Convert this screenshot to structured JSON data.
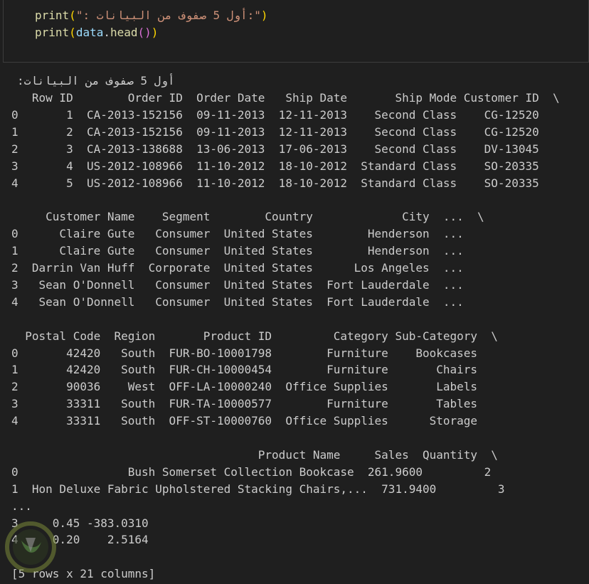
{
  "code": {
    "line1": {
      "fn": "print",
      "open": "(",
      "str": "\": أول 5 صفوف من البيانات:\"",
      "close": ")"
    },
    "line2": {
      "fn": "print",
      "open": "(",
      "obj": "data",
      "dot": ".",
      "method": "head",
      "inner_open": "(",
      "inner_close": ")",
      "close": ")"
    }
  },
  "output": {
    "heading": "أول 5 صفوف من البيانات:",
    "lines": [
      "   Row ID        Order ID  Order Date   Ship Date       Ship Mode Customer ID  \\",
      "0       1  CA-2013-152156  09-11-2013  12-11-2013    Second Class    CG-12520",
      "1       2  CA-2013-152156  09-11-2013  12-11-2013    Second Class    CG-12520",
      "2       3  CA-2013-138688  13-06-2013  17-06-2013    Second Class    DV-13045",
      "3       4  US-2012-108966  11-10-2012  18-10-2012  Standard Class    SO-20335",
      "4       5  US-2012-108966  11-10-2012  18-10-2012  Standard Class    SO-20335",
      "",
      "     Customer Name    Segment        Country             City  ...  \\",
      "0      Claire Gute   Consumer  United States        Henderson  ...",
      "1      Claire Gute   Consumer  United States        Henderson  ...",
      "2  Darrin Van Huff  Corporate  United States      Los Angeles  ...",
      "3   Sean O'Donnell   Consumer  United States  Fort Lauderdale  ...",
      "4   Sean O'Donnell   Consumer  United States  Fort Lauderdale  ...",
      "",
      "  Postal Code  Region       Product ID         Category Sub-Category  \\",
      "0       42420   South  FUR-BO-10001798        Furniture    Bookcases",
      "1       42420   South  FUR-CH-10000454        Furniture       Chairs",
      "2       90036    West  OFF-LA-10000240  Office Supplies       Labels",
      "3       33311   South  FUR-TA-10000577        Furniture       Tables",
      "4       33311   South  OFF-ST-10000760  Office Supplies      Storage",
      "",
      "                                    Product Name     Sales  Quantity  \\",
      "0                Bush Somerset Collection Bookcase  261.9600         2",
      "1  Hon Deluxe Fabric Upholstered Stacking Chairs,...  731.9400         3",
      "...",
      "3     0.45 -383.0310",
      "4     0.20    2.5164",
      "",
      "[5 rows x 21 columns]"
    ]
  }
}
